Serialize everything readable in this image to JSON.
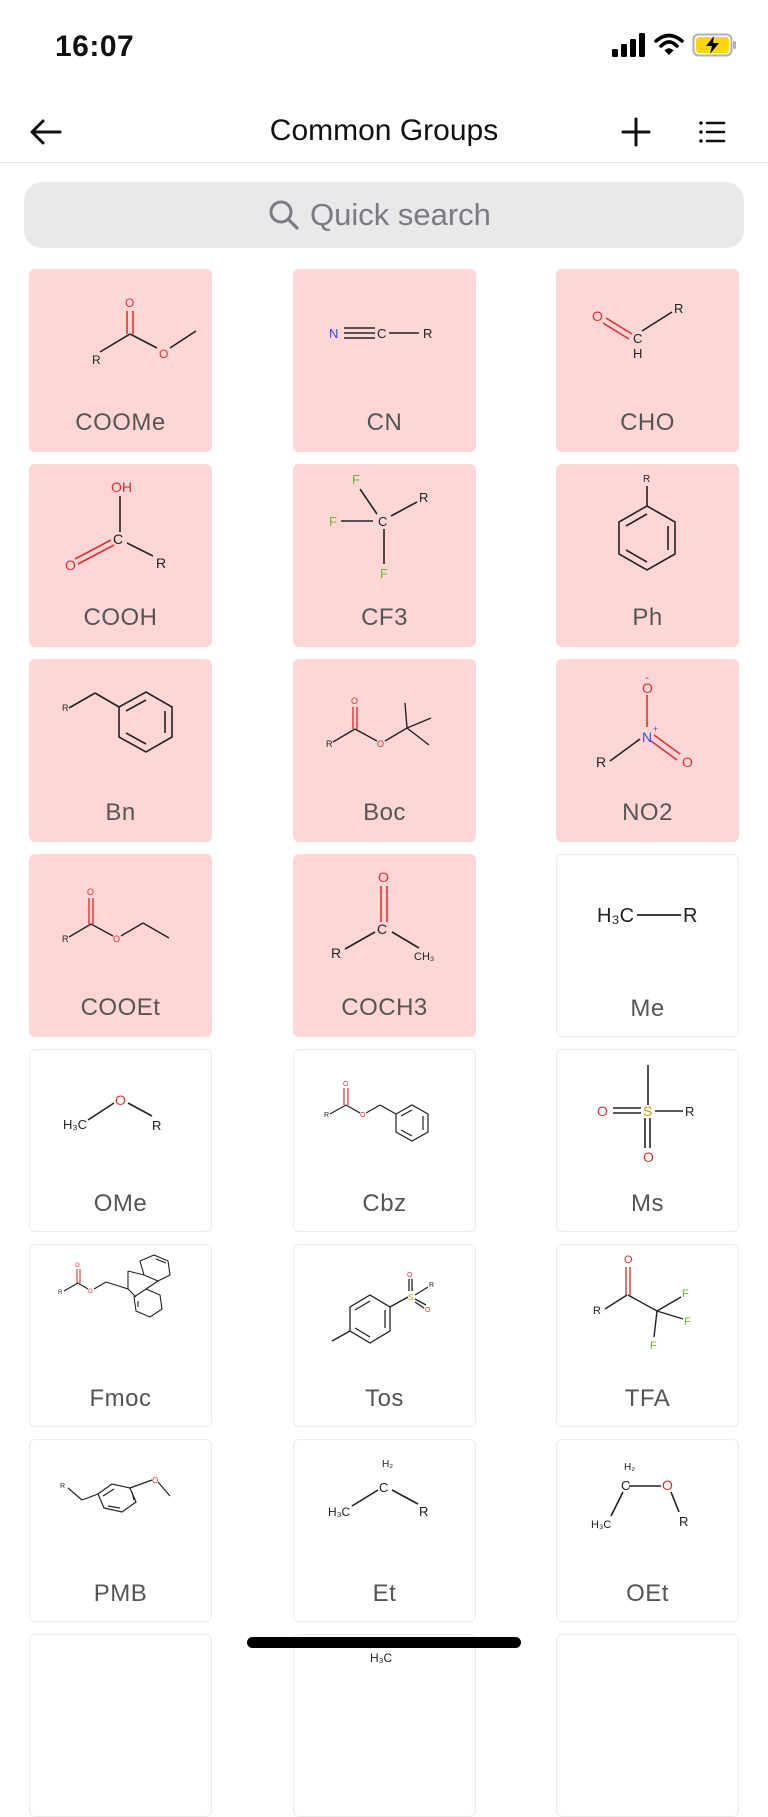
{
  "status_bar": {
    "time": "16:07"
  },
  "nav": {
    "title": "Common Groups"
  },
  "search": {
    "placeholder": "Quick search",
    "value": ""
  },
  "colors": {
    "highlight": "#ffd6d6",
    "plain_border": "#ececec",
    "battery_fill": "#ffd60a"
  },
  "groups": [
    {
      "label": "COOMe",
      "highlighted": true
    },
    {
      "label": "CN",
      "highlighted": true
    },
    {
      "label": "CHO",
      "highlighted": true
    },
    {
      "label": "COOH",
      "highlighted": true
    },
    {
      "label": "CF3",
      "highlighted": true
    },
    {
      "label": "Ph",
      "highlighted": true
    },
    {
      "label": "Bn",
      "highlighted": true
    },
    {
      "label": "Boc",
      "highlighted": true
    },
    {
      "label": "NO2",
      "highlighted": true
    },
    {
      "label": "COOEt",
      "highlighted": true
    },
    {
      "label": "COCH3",
      "highlighted": true
    },
    {
      "label": "Me",
      "highlighted": false
    },
    {
      "label": "OMe",
      "highlighted": false
    },
    {
      "label": "Cbz",
      "highlighted": false
    },
    {
      "label": "Ms",
      "highlighted": false
    },
    {
      "label": "Fmoc",
      "highlighted": false
    },
    {
      "label": "Tos",
      "highlighted": false
    },
    {
      "label": "TFA",
      "highlighted": false
    },
    {
      "label": "PMB",
      "highlighted": false
    },
    {
      "label": "Et",
      "highlighted": false
    },
    {
      "label": "OEt",
      "highlighted": false
    }
  ],
  "atoms": {
    "R": "R",
    "O": "O",
    "N": "N",
    "C": "C",
    "H": "H",
    "F": "F",
    "S": "S",
    "OH": "OH",
    "H3C": "H₃C",
    "CH3": "CH₃",
    "H2": "H₂",
    "minus": "-",
    "plus": "+"
  }
}
